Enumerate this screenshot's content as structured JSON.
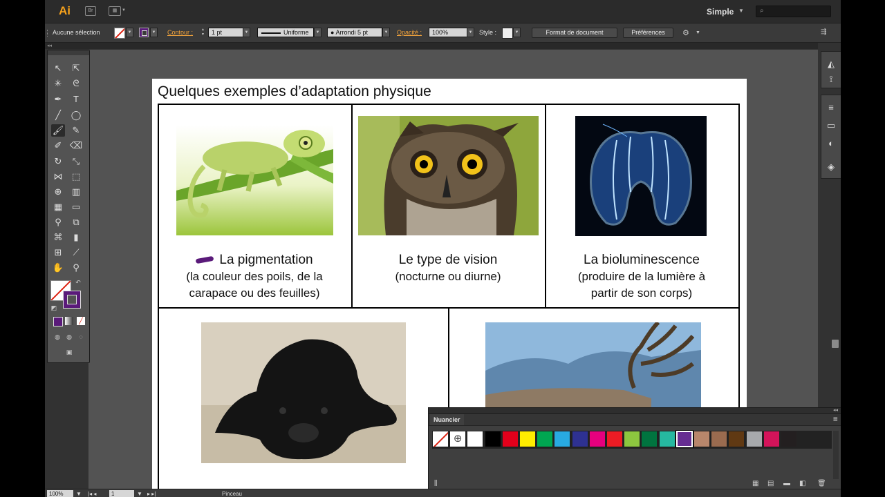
{
  "app": {
    "logo": "Ai",
    "bridge_label": "Br",
    "workspace": "Simple",
    "search_placeholder": ""
  },
  "control_bar": {
    "selection_label": "Aucune sélection",
    "stroke_label": "Contour :",
    "stroke_weight": "1 pt",
    "profile": "Uniforme",
    "brush": "Arrondi 5 pt",
    "opacity_label": "Opacité :",
    "opacity_value": "100%",
    "style_label": "Style :",
    "doc_format_button": "Format de document",
    "preferences_button": "Préférences"
  },
  "document": {
    "title": "Quelques exemples d’adaptation physique",
    "cells": [
      {
        "title": "La pigmentation",
        "sub1": "(la couleur des poils, de la",
        "sub2": "carapace ou des feuilles)"
      },
      {
        "title": "Le type de vision",
        "sub1": "(nocturne ou diurne)",
        "sub2": ""
      },
      {
        "title": "La bioluminescence",
        "sub1": "(produire de la lumière à",
        "sub2": "partir de son corps)"
      }
    ]
  },
  "status_bar": {
    "zoom": "100%",
    "artboard_number": "1",
    "current_tool": "Pinceau"
  },
  "swatches_panel": {
    "tab_label": "Nuancier",
    "swatches": [
      "none",
      "registration",
      "#ffffff",
      "#000000",
      "#e3001b",
      "#ffed00",
      "#00a651",
      "#28aae1",
      "#2e3192",
      "#e6007e",
      "#ed1c24",
      "#8dc63f",
      "#00743f",
      "#26b8a0",
      "#662d91",
      "#b8866b",
      "#9a6b4f",
      "#603913",
      "#a7a9ac",
      "#d4145a",
      "#231f20"
    ],
    "selected_index": 14
  },
  "colors": {
    "accent_orange": "#f7a21b",
    "stroke_purple": "#5a1a7a"
  }
}
